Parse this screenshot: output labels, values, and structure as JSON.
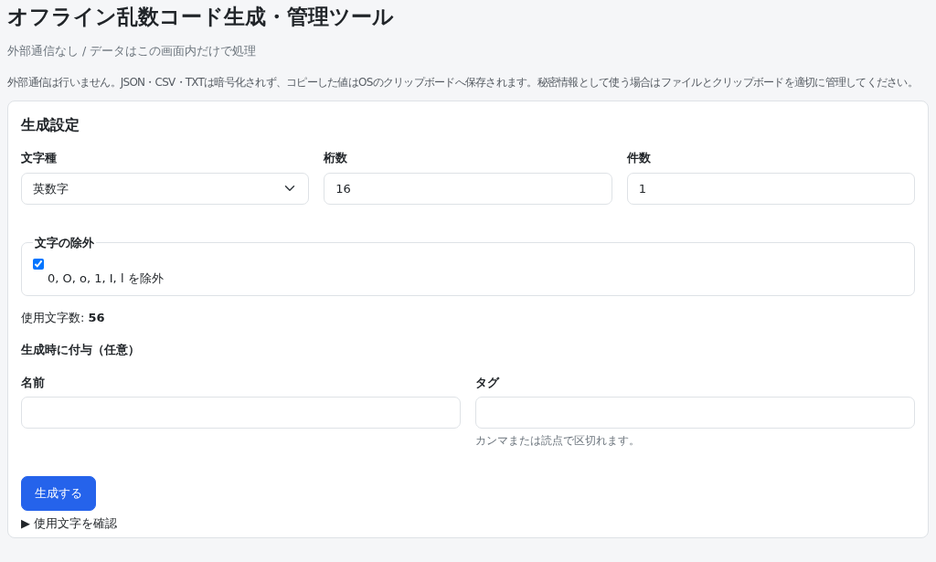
{
  "title": "オフライン乱数コード生成・管理ツール",
  "subtitle": "外部通信なし / データはこの画面内だけで処理",
  "notice": "外部通信は行いません。JSON・CSV・TXTは暗号化されず、コピーした値はOSのクリップボードへ保存されます。秘密情報として使う場合はファイルとクリップボードを適切に管理してください。",
  "settings": {
    "heading": "生成設定",
    "fields": [
      {
        "kind": "select",
        "label": "文字種",
        "value": "英数字"
      },
      {
        "kind": "input",
        "label": "桁数",
        "value": "16"
      },
      {
        "kind": "input",
        "label": "件数",
        "value": "1"
      }
    ],
    "exclusion": {
      "legend": "文字の除外",
      "label": "0, O, o, 1, I, l を除外",
      "checked": true
    },
    "char_count": "使用文字数: **56**",
    "extras_heading": "生成時に付与（任意）",
    "extras": [
      {
        "label": "名前"
      },
      {
        "label": "タグ",
        "help": "カンマまたは読点で区切れます。"
      }
    ],
    "generate_button": "生成する",
    "details": {
      "marker": "▶",
      "label": "使用文字を確認"
    }
  }
}
